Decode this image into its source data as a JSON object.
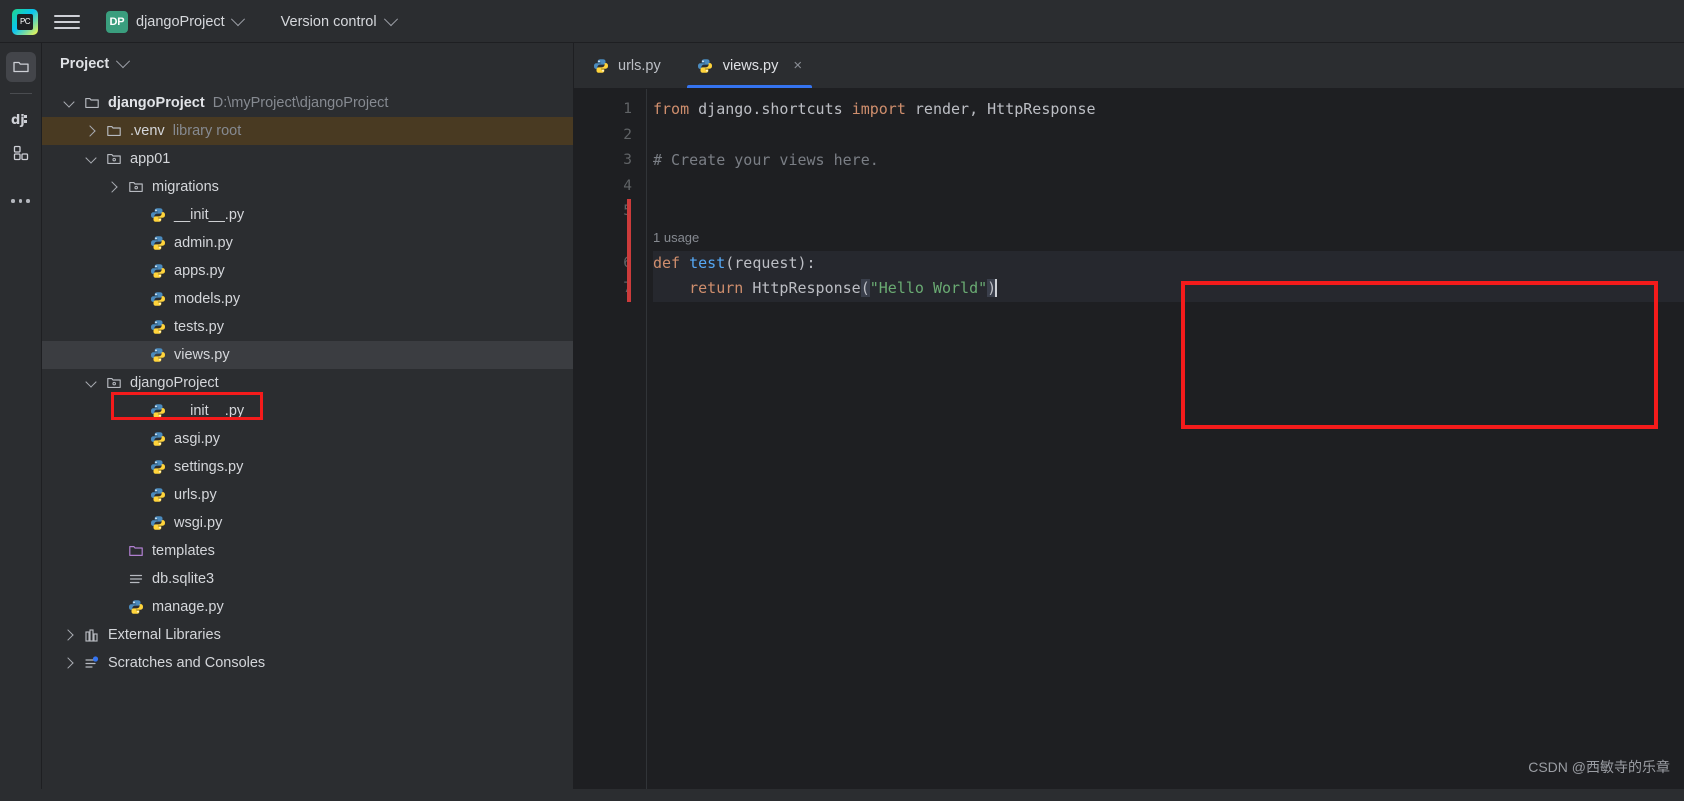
{
  "titlebar": {
    "logo_text": "PC",
    "menu_icon": "hamburger-icon",
    "project_badge": "DP",
    "project_name": "djangoProject",
    "vcs_label": "Version control"
  },
  "stripe": {
    "items": [
      {
        "icon": "folder-icon",
        "name": "project-tool-window",
        "active": true
      },
      {
        "icon": "django-icon",
        "name": "django-tool-window",
        "active": false
      },
      {
        "icon": "structure-icon",
        "name": "structure-tool-window",
        "active": false
      },
      {
        "icon": "more-icon",
        "name": "more-tool-windows",
        "active": false
      }
    ]
  },
  "project_panel": {
    "title": "Project",
    "tree": [
      {
        "depth": 0,
        "twisty": "down",
        "icon": "folder-icon",
        "label": "djangoProject",
        "bold": true,
        "suffix": "D:\\myProject\\djangoProject",
        "state": "normal"
      },
      {
        "depth": 1,
        "twisty": "right",
        "icon": "folder-icon",
        "label": ".venv",
        "bold": false,
        "suffix": "library root",
        "state": "venv-highlight"
      },
      {
        "depth": 1,
        "twisty": "down",
        "icon": "module-icon",
        "label": "app01",
        "bold": false,
        "suffix": "",
        "state": "normal"
      },
      {
        "depth": 2,
        "twisty": "right",
        "icon": "module-icon",
        "label": "migrations",
        "bold": false,
        "suffix": "",
        "state": "normal"
      },
      {
        "depth": 3,
        "twisty": "none",
        "icon": "python-icon",
        "label": "__init__.py",
        "bold": false,
        "suffix": "",
        "state": "normal"
      },
      {
        "depth": 3,
        "twisty": "none",
        "icon": "python-icon",
        "label": "admin.py",
        "bold": false,
        "suffix": "",
        "state": "normal"
      },
      {
        "depth": 3,
        "twisty": "none",
        "icon": "python-icon",
        "label": "apps.py",
        "bold": false,
        "suffix": "",
        "state": "normal"
      },
      {
        "depth": 3,
        "twisty": "none",
        "icon": "python-icon",
        "label": "models.py",
        "bold": false,
        "suffix": "",
        "state": "normal"
      },
      {
        "depth": 3,
        "twisty": "none",
        "icon": "python-icon",
        "label": "tests.py",
        "bold": false,
        "suffix": "",
        "state": "normal"
      },
      {
        "depth": 3,
        "twisty": "none",
        "icon": "python-icon",
        "label": "views.py",
        "bold": false,
        "suffix": "",
        "state": "selected"
      },
      {
        "depth": 1,
        "twisty": "down",
        "icon": "module-icon",
        "label": "djangoProject",
        "bold": false,
        "suffix": "",
        "state": "normal"
      },
      {
        "depth": 3,
        "twisty": "none",
        "icon": "python-icon",
        "label": "__init__.py",
        "bold": false,
        "suffix": "",
        "state": "normal"
      },
      {
        "depth": 3,
        "twisty": "none",
        "icon": "python-icon",
        "label": "asgi.py",
        "bold": false,
        "suffix": "",
        "state": "normal"
      },
      {
        "depth": 3,
        "twisty": "none",
        "icon": "python-icon",
        "label": "settings.py",
        "bold": false,
        "suffix": "",
        "state": "normal"
      },
      {
        "depth": 3,
        "twisty": "none",
        "icon": "python-icon",
        "label": "urls.py",
        "bold": false,
        "suffix": "",
        "state": "normal"
      },
      {
        "depth": 3,
        "twisty": "none",
        "icon": "python-icon",
        "label": "wsgi.py",
        "bold": false,
        "suffix": "",
        "state": "normal"
      },
      {
        "depth": 2,
        "twisty": "none",
        "icon": "templates-icon",
        "label": "templates",
        "bold": false,
        "suffix": "",
        "state": "normal"
      },
      {
        "depth": 2,
        "twisty": "none",
        "icon": "db-icon",
        "label": "db.sqlite3",
        "bold": false,
        "suffix": "",
        "state": "normal"
      },
      {
        "depth": 2,
        "twisty": "none",
        "icon": "python-icon",
        "label": "manage.py",
        "bold": false,
        "suffix": "",
        "state": "normal"
      },
      {
        "depth": 0,
        "twisty": "right",
        "icon": "library-icon",
        "label": "External Libraries",
        "bold": false,
        "suffix": "",
        "state": "normal"
      },
      {
        "depth": 0,
        "twisty": "right",
        "icon": "scratches-icon",
        "label": "Scratches and Consoles",
        "bold": false,
        "suffix": "",
        "state": "normal"
      }
    ]
  },
  "editor": {
    "tabs": [
      {
        "label": "urls.py",
        "icon": "python-icon",
        "active": false,
        "closable": false
      },
      {
        "label": "views.py",
        "icon": "python-icon",
        "active": true,
        "closable": true,
        "close_glyph": "×"
      }
    ],
    "line_numbers": [
      "1",
      "2",
      "3",
      "4",
      "5",
      "6",
      "7"
    ],
    "inlay_hint": "1 usage",
    "code": {
      "l1_kw_from": "from",
      "l1_module": "django.shortcuts",
      "l1_kw_import": "import",
      "l1_names": "render, HttpResponse",
      "l3_comment": "# Create your views here.",
      "l6_kw_def": "def",
      "l6_fname": "test",
      "l6_params": "(request):",
      "l7_kw_return": "return",
      "l7_call": "HttpResponse",
      "l7_open": "(",
      "l7_string": "\"Hello World\"",
      "l7_close": ")"
    }
  },
  "annotations": {
    "code_box_color": "#f41b1b",
    "file_box_color": "#f41b1b"
  },
  "watermark": "CSDN @西敏寺的乐章"
}
